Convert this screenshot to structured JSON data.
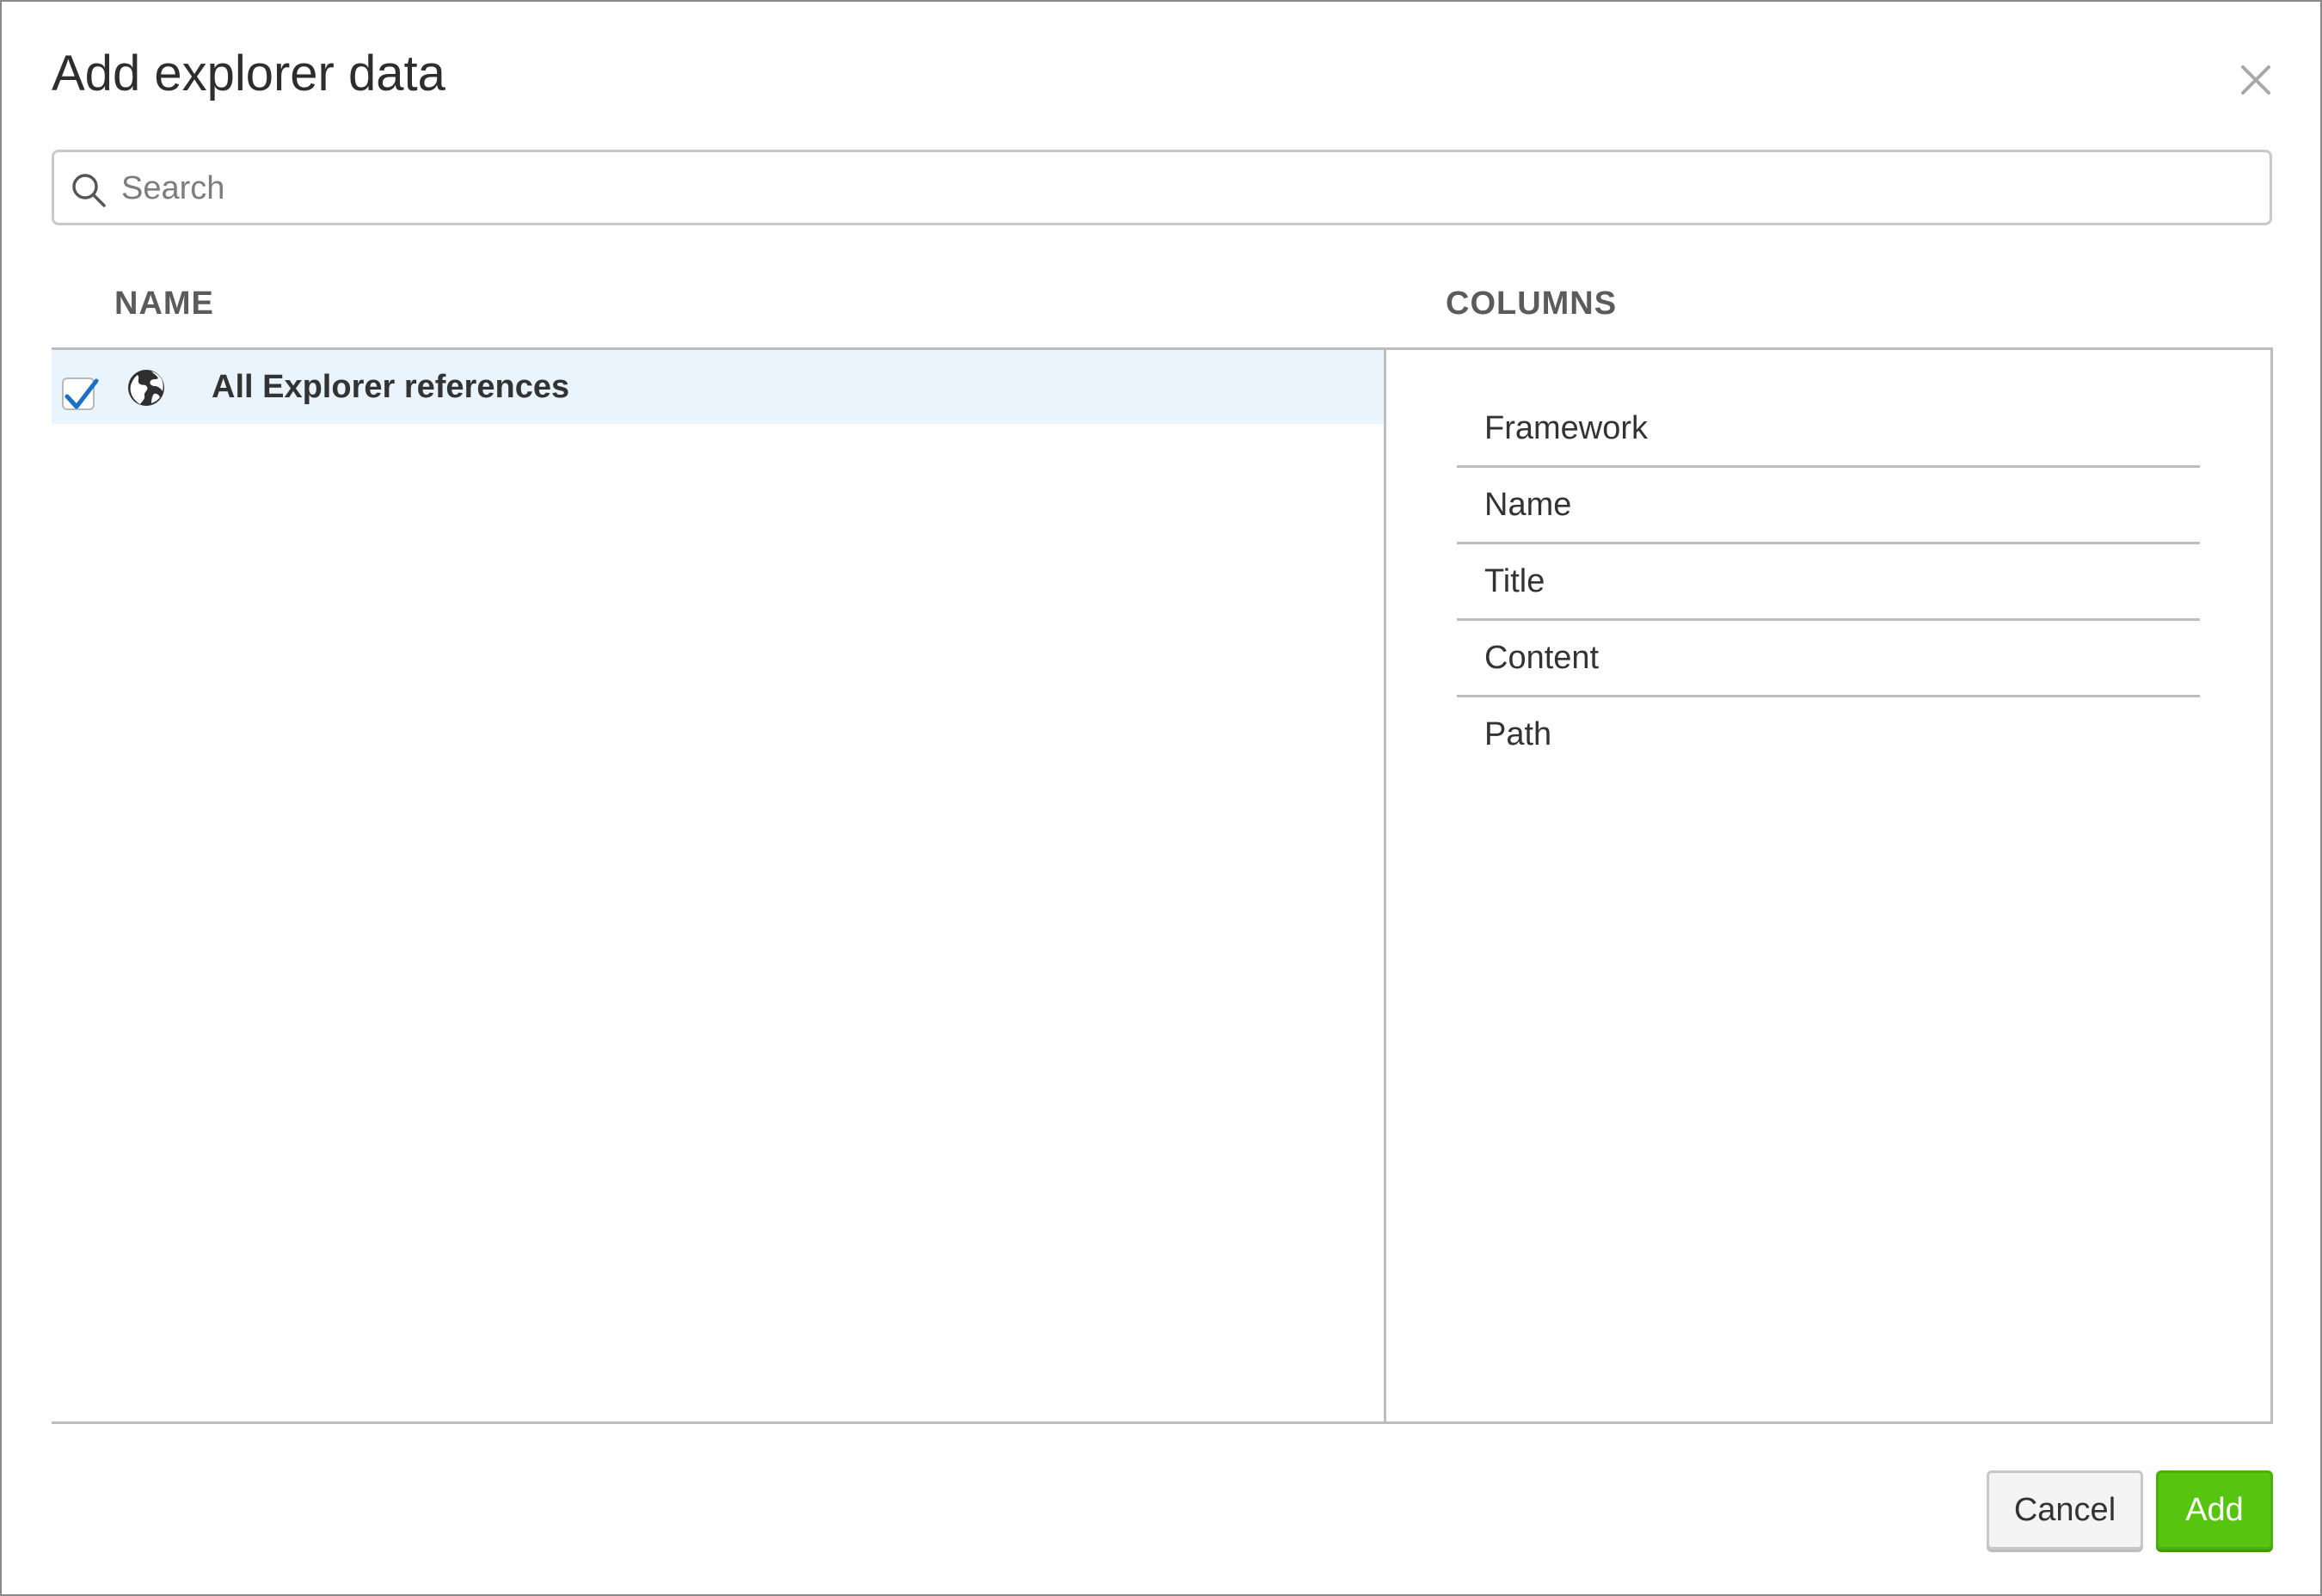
{
  "dialog": {
    "title": "Add explorer data",
    "close_icon": "close-icon"
  },
  "search": {
    "placeholder": "Search",
    "value": "",
    "icon": "search-icon"
  },
  "table": {
    "headers": {
      "name": "NAME",
      "columns": "COLUMNS"
    },
    "rows": [
      {
        "label": "All Explorer references",
        "checked": true,
        "icon": "globe-icon"
      }
    ],
    "columns": [
      "Framework",
      "Name",
      "Title",
      "Content",
      "Path"
    ]
  },
  "footer": {
    "cancel_label": "Cancel",
    "add_label": "Add"
  },
  "colors": {
    "selected_row": "#e9f4fd",
    "add_button": "#57c50f",
    "checkmark": "#1a6fc9"
  }
}
